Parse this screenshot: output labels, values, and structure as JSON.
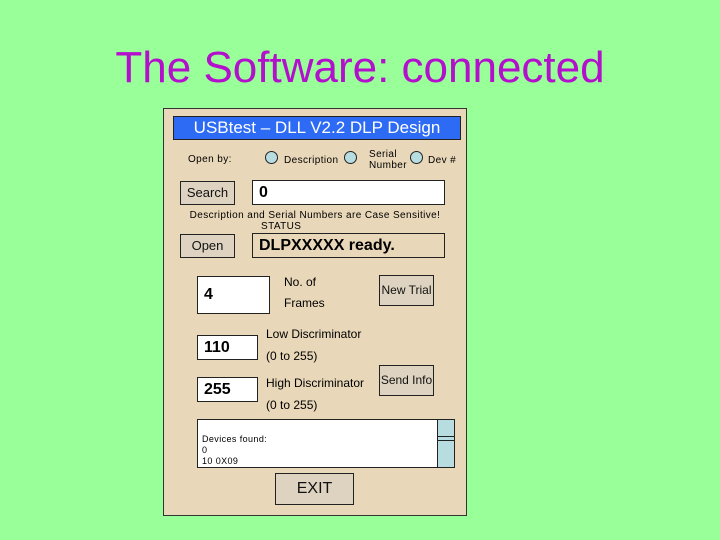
{
  "slide": {
    "title": "The Software: connected"
  },
  "window": {
    "title": "USBtest – DLL V2.2 DLP Design",
    "open_by_label": "Open by:",
    "radios": [
      {
        "label": "Description"
      },
      {
        "label_line1": "Serial",
        "label_line2": "Number"
      },
      {
        "label": "Dev #"
      }
    ],
    "search_button": "Search",
    "search_field_value": "0",
    "case_note": "Description and Serial Numbers are Case Sensitive!",
    "status_label": "STATUS",
    "open_button": "Open",
    "status_value": "DLPXXXXX ready.",
    "frames": {
      "value": "4",
      "label_line1": "No. of",
      "label_line2": "Frames"
    },
    "new_trial_button": "New Trial",
    "low_disc": {
      "value": "110",
      "label": "Low Discriminator",
      "range": "(0 to 255)"
    },
    "high_disc": {
      "value": "255",
      "label": "High Discriminator",
      "range": "(0 to 255)"
    },
    "send_info_button": "Send Info",
    "log_lines": [
      "Devices found:",
      "0",
      "10 0X09"
    ],
    "exit_button": "EXIT"
  },
  "colors": {
    "background": "#99ff99",
    "title": "#b30fcc",
    "title_bar": "#2d6bf5",
    "panel": "#e8d7b8"
  }
}
